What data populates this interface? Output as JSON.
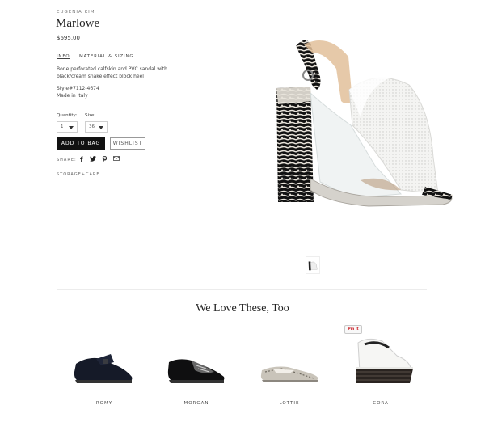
{
  "product": {
    "brand": "EUGENIA KIM",
    "name": "Marlowe",
    "price": "$695.00",
    "description": "Bone perforated calfskin and PVC sandal with black/cream snake effect block heel",
    "style": "Style#7112-4674",
    "origin": "Made in Italy",
    "image_icon": "main-shoe-image"
  },
  "tabs": [
    {
      "label": "INFO",
      "active": true
    },
    {
      "label": "MATERIAL & SIZING",
      "active": false
    }
  ],
  "form": {
    "quantity_label": "Quantity:",
    "quantity_value": "1",
    "size_label": "Size:",
    "size_value": "36"
  },
  "actions": {
    "add_to_bag": "ADD TO BAG",
    "wishlist": "WISHLIST"
  },
  "share": {
    "label": "SHARE:",
    "icons": [
      "facebook-icon",
      "twitter-icon",
      "pinterest-icon",
      "email-icon"
    ]
  },
  "storage_link": "STORAGE+CARE",
  "related": {
    "title": "We Love These, Too",
    "pinit_label": "Pin it",
    "items": [
      {
        "name": "ROMY"
      },
      {
        "name": "MORGAN"
      },
      {
        "name": "LOTTIE"
      },
      {
        "name": "CORA"
      }
    ]
  },
  "colors": {
    "accent": "#111111",
    "pinit": "#cb2027"
  }
}
